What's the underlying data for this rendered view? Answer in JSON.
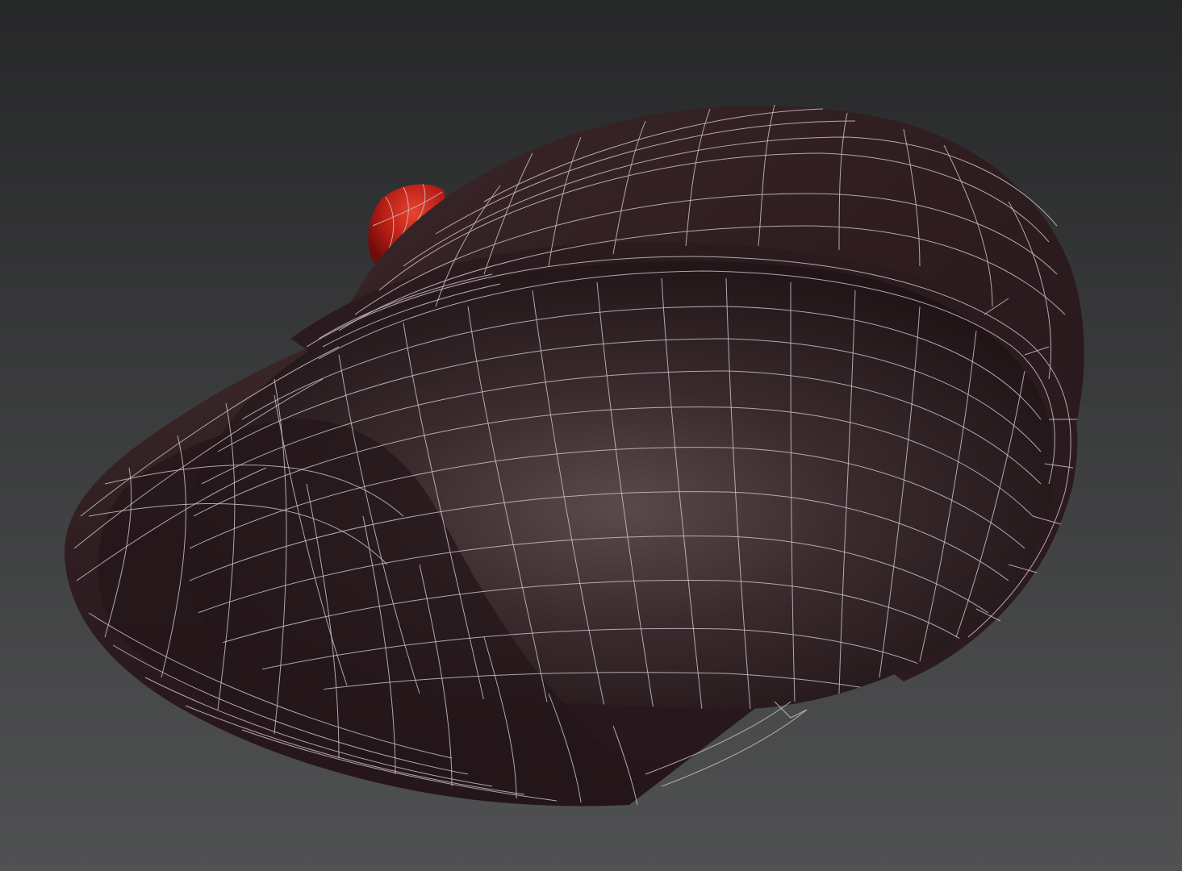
{
  "viewport": {
    "background_top": "#262728",
    "background_bottom": "#505152",
    "wireframe_color": "#c9c2c6"
  },
  "model": {
    "object": "cap",
    "shell_color": "#3a2326",
    "inner_color": "#2a1a1d",
    "highlight_color": "#5a4a4c",
    "button_color": "#c0201a",
    "display_mode": "smooth-shaded-with-wireframe"
  }
}
